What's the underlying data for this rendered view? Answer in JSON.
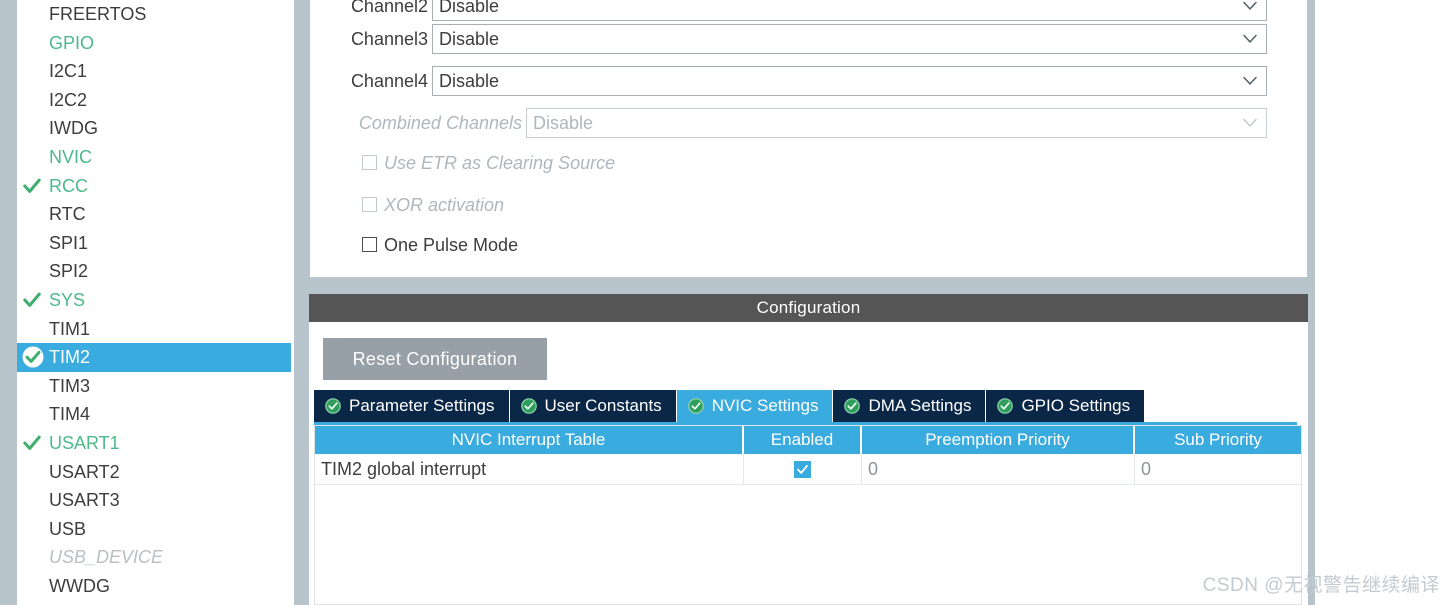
{
  "sidebar": {
    "items": [
      {
        "label": "FREERTOS",
        "state": "normal",
        "checked": false
      },
      {
        "label": "GPIO",
        "state": "green",
        "checked": false
      },
      {
        "label": "I2C1",
        "state": "normal",
        "checked": false
      },
      {
        "label": "I2C2",
        "state": "normal",
        "checked": false
      },
      {
        "label": "IWDG",
        "state": "normal",
        "checked": false
      },
      {
        "label": "NVIC",
        "state": "green",
        "checked": false
      },
      {
        "label": "RCC",
        "state": "green",
        "checked": true
      },
      {
        "label": "RTC",
        "state": "normal",
        "checked": false
      },
      {
        "label": "SPI1",
        "state": "normal",
        "checked": false
      },
      {
        "label": "SPI2",
        "state": "normal",
        "checked": false
      },
      {
        "label": "SYS",
        "state": "green",
        "checked": true
      },
      {
        "label": "TIM1",
        "state": "normal",
        "checked": false
      },
      {
        "label": "TIM2",
        "state": "selected",
        "checked": true
      },
      {
        "label": "TIM3",
        "state": "normal",
        "checked": false
      },
      {
        "label": "TIM4",
        "state": "normal",
        "checked": false
      },
      {
        "label": "USART1",
        "state": "green",
        "checked": true
      },
      {
        "label": "USART2",
        "state": "normal",
        "checked": false
      },
      {
        "label": "USART3",
        "state": "normal",
        "checked": false
      },
      {
        "label": "USB",
        "state": "normal",
        "checked": false
      },
      {
        "label": "USB_DEVICE",
        "state": "disabled",
        "checked": false
      },
      {
        "label": "WWDG",
        "state": "normal",
        "checked": false
      }
    ]
  },
  "mode_panel": {
    "rows": [
      {
        "label": "Channel2",
        "value": "Disable",
        "enabled": true,
        "clipped": true
      },
      {
        "label": "Channel3",
        "value": "Disable",
        "enabled": true,
        "clipped": false
      },
      {
        "label": "Channel4",
        "value": "Disable",
        "enabled": true,
        "clipped": false
      },
      {
        "label": "Combined Channels",
        "value": "Disable",
        "enabled": false,
        "clipped": false
      }
    ],
    "checkboxes": [
      {
        "label": "Use ETR as Clearing Source",
        "checked": false,
        "enabled": false
      },
      {
        "label": "XOR activation",
        "checked": false,
        "enabled": false
      },
      {
        "label": "One Pulse Mode",
        "checked": false,
        "enabled": true
      }
    ]
  },
  "configuration": {
    "header_title": "Configuration",
    "reset_button_label": "Reset Configuration",
    "tabs": [
      {
        "label": "Parameter Settings",
        "active": false
      },
      {
        "label": "User Constants",
        "active": false
      },
      {
        "label": "NVIC Settings",
        "active": true
      },
      {
        "label": "DMA Settings",
        "active": false
      },
      {
        "label": "GPIO Settings",
        "active": false
      }
    ],
    "nvic_table": {
      "columns": [
        "NVIC Interrupt Table",
        "Enabled",
        "Preemption Priority",
        "Sub Priority"
      ],
      "rows": [
        {
          "name": "TIM2 global interrupt",
          "enabled": true,
          "preemption_priority": "0",
          "sub_priority": "0"
        }
      ]
    }
  },
  "watermark": {
    "text": "CSDN @无视警告继续编译"
  },
  "colors": {
    "accent_blue": "#3aabdf",
    "tab_navy": "#0b2748",
    "green_check": "#4cb98a",
    "header_gray": "#555555",
    "panel_gray": "#b7c4cc",
    "button_gray": "#97a0a6"
  }
}
